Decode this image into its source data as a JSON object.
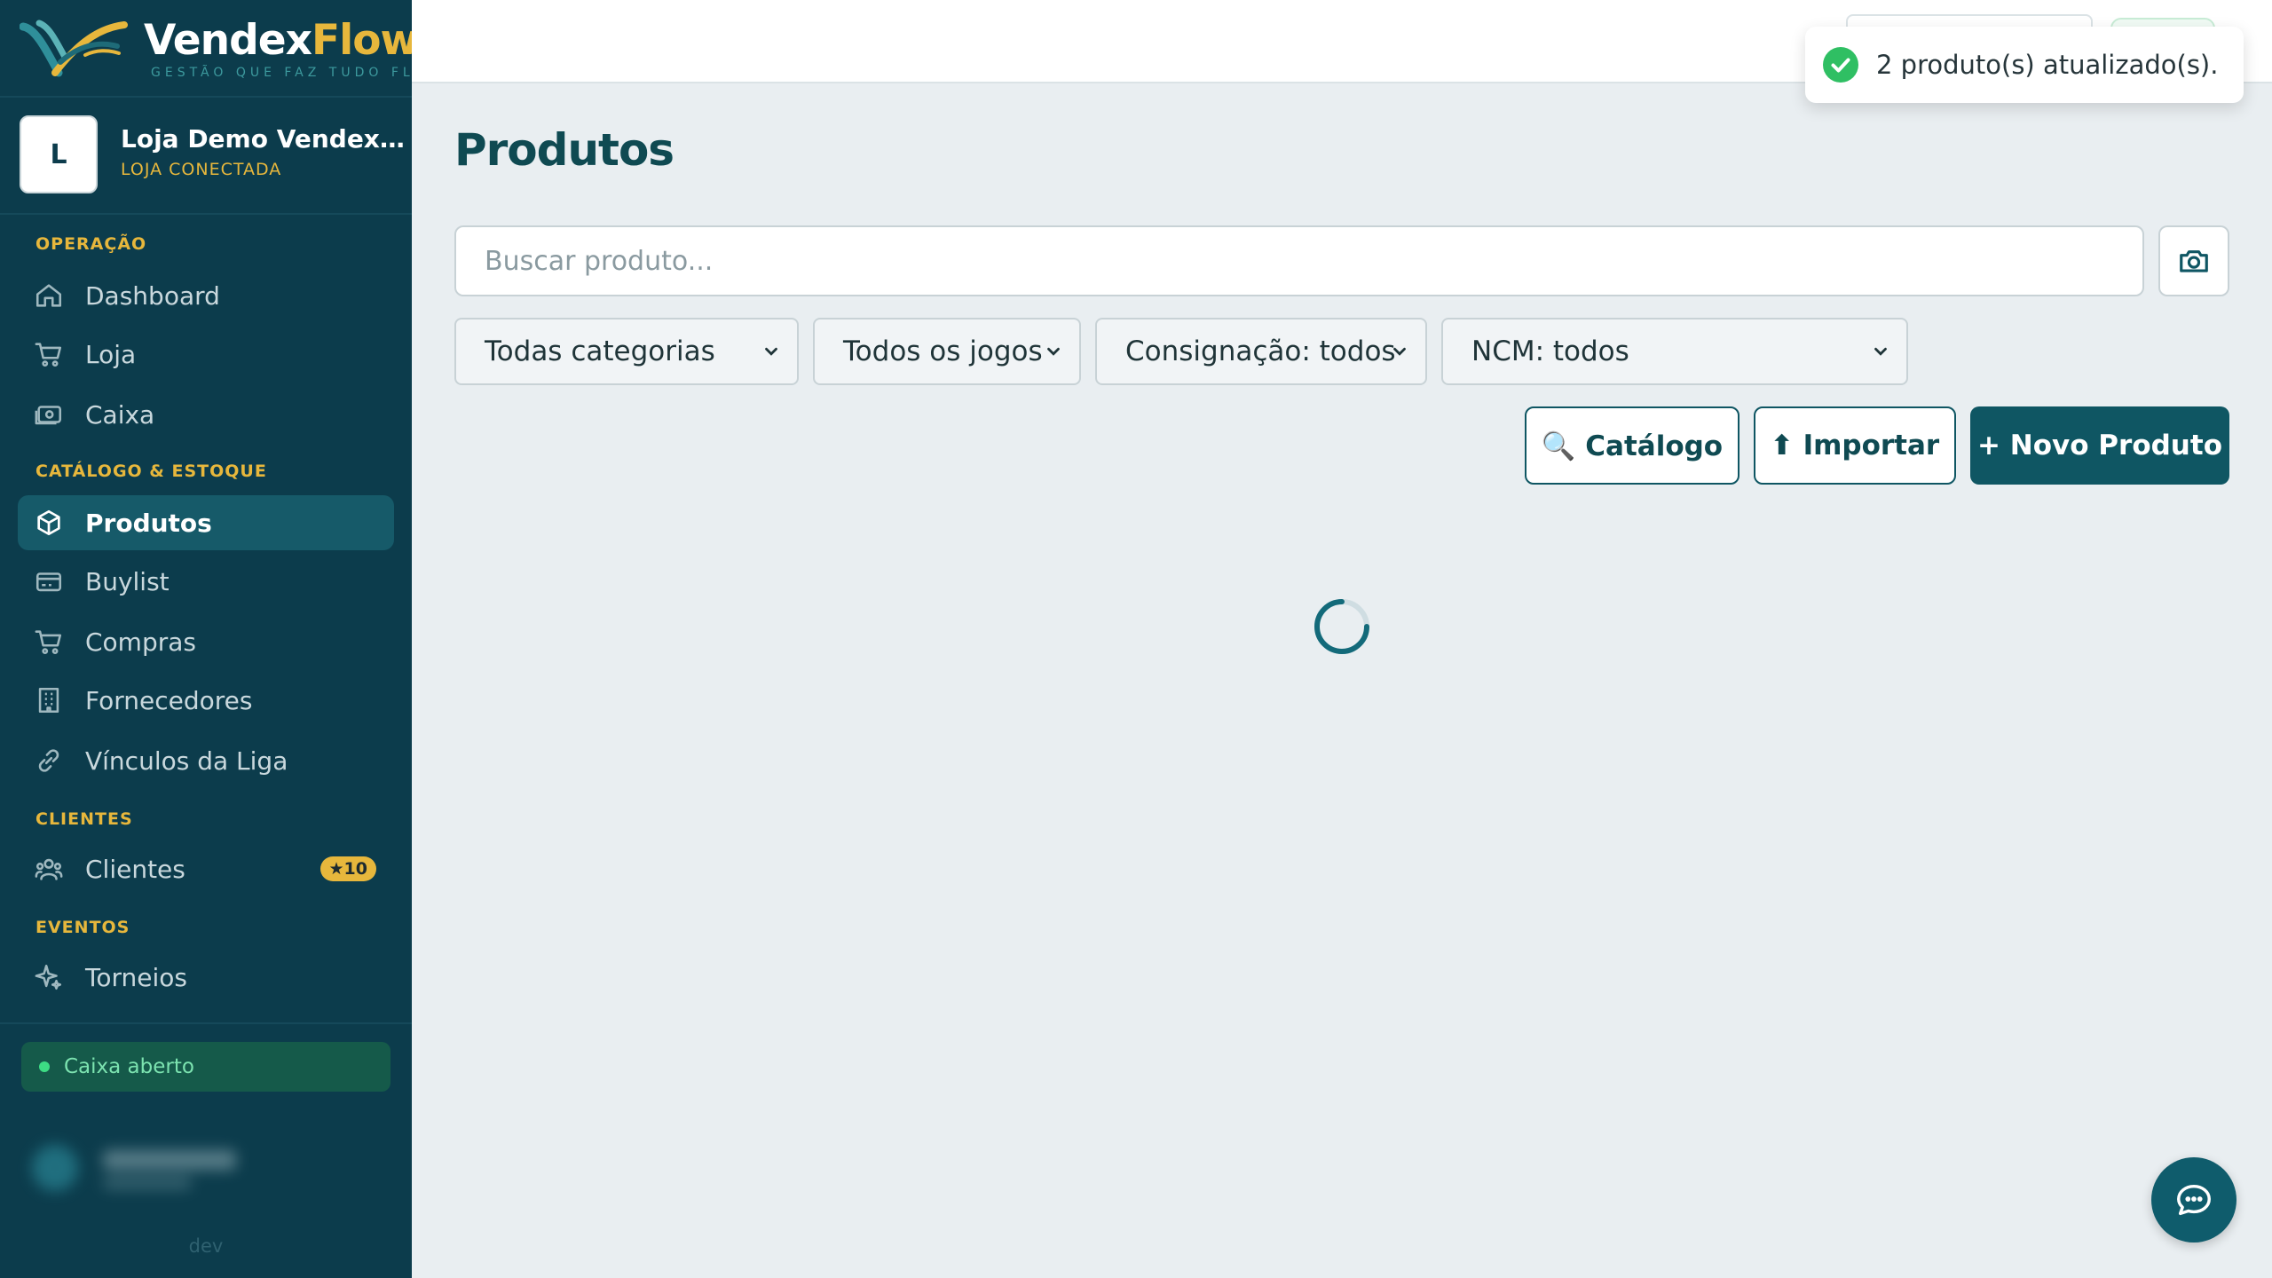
{
  "brand": {
    "name_part1": "Vendex",
    "name_part2": "Flow",
    "tagline": "GESTÃO QUE FAZ TUDO FLUIR"
  },
  "store": {
    "avatar_letter": "L",
    "name": "Loja Demo VendexFlow",
    "status": "LOJA CONECTADA"
  },
  "sidebar": {
    "sections": {
      "operacao": "OPERAÇÃO",
      "catalogo": "CATÁLOGO & ESTOQUE",
      "clientes": "CLIENTES",
      "eventos": "EVENTOS"
    },
    "items": {
      "dashboard": "Dashboard",
      "loja": "Loja",
      "caixa": "Caixa",
      "produtos": "Produtos",
      "buylist": "Buylist",
      "compras": "Compras",
      "fornecedores": "Fornecedores",
      "vinculos": "Vínculos da Liga",
      "clientes": "Clientes",
      "torneios": "Torneios"
    },
    "active_item": "produtos",
    "clientes_badge": "★10",
    "caixa_status": "Caixa aberto",
    "environment": "dev"
  },
  "toast": {
    "message": "2 produto(s) atualizado(s)."
  },
  "main": {
    "title": "Produtos",
    "search": {
      "placeholder": "Buscar produto...",
      "value": ""
    },
    "filters": {
      "categoria": "Todas categorias",
      "jogo": "Todos os jogos",
      "consignacao": "Consignação: todos",
      "ncm": "NCM: todos"
    },
    "actions": {
      "catalogo": "🔍 Catálogo",
      "importar": "⬆ Importar",
      "novo": "+ Novo Produto"
    },
    "loading": true
  },
  "colors": {
    "sidebar_bg": "#0c3c4c",
    "accent": "#0f5663",
    "gold": "#e7b73c",
    "success": "#2fbf63"
  },
  "icons": {
    "dashboard": "home-icon",
    "loja": "cart-icon",
    "caixa": "register-icon",
    "produtos": "box-icon",
    "buylist": "card-icon",
    "compras": "cart-icon",
    "fornecedores": "building-icon",
    "vinculos": "link-icon",
    "clientes": "users-icon",
    "torneios": "sparkle-icon",
    "search_camera": "camera-icon",
    "chat": "chat-icon"
  }
}
